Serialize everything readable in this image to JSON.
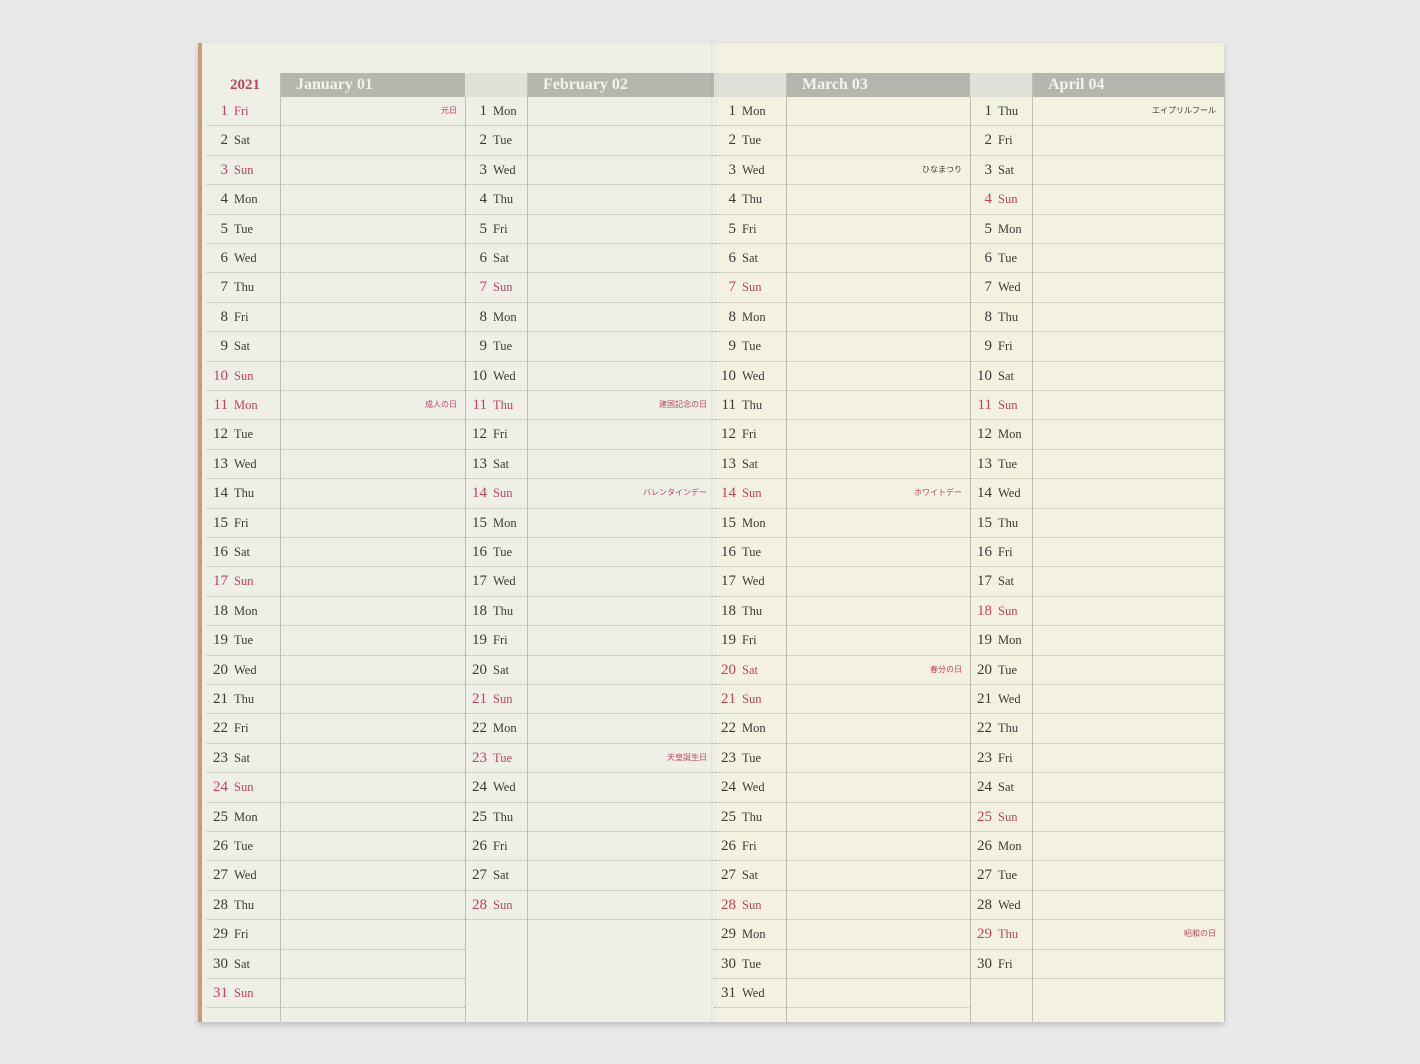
{
  "year": "2021",
  "months": [
    {
      "title": "January 01",
      "days": [
        {
          "d": "1",
          "w": "Fri",
          "red": true,
          "note": "元日"
        },
        {
          "d": "2",
          "w": "Sat"
        },
        {
          "d": "3",
          "w": "Sun",
          "red": true
        },
        {
          "d": "4",
          "w": "Mon"
        },
        {
          "d": "5",
          "w": "Tue"
        },
        {
          "d": "6",
          "w": "Wed"
        },
        {
          "d": "7",
          "w": "Thu"
        },
        {
          "d": "8",
          "w": "Fri"
        },
        {
          "d": "9",
          "w": "Sat"
        },
        {
          "d": "10",
          "w": "Sun",
          "red": true
        },
        {
          "d": "11",
          "w": "Mon",
          "red": true,
          "note": "成人の日"
        },
        {
          "d": "12",
          "w": "Tue"
        },
        {
          "d": "13",
          "w": "Wed"
        },
        {
          "d": "14",
          "w": "Thu"
        },
        {
          "d": "15",
          "w": "Fri"
        },
        {
          "d": "16",
          "w": "Sat"
        },
        {
          "d": "17",
          "w": "Sun",
          "red": true
        },
        {
          "d": "18",
          "w": "Mon"
        },
        {
          "d": "19",
          "w": "Tue"
        },
        {
          "d": "20",
          "w": "Wed"
        },
        {
          "d": "21",
          "w": "Thu"
        },
        {
          "d": "22",
          "w": "Fri"
        },
        {
          "d": "23",
          "w": "Sat"
        },
        {
          "d": "24",
          "w": "Sun",
          "red": true
        },
        {
          "d": "25",
          "w": "Mon"
        },
        {
          "d": "26",
          "w": "Tue"
        },
        {
          "d": "27",
          "w": "Wed"
        },
        {
          "d": "28",
          "w": "Thu"
        },
        {
          "d": "29",
          "w": "Fri"
        },
        {
          "d": "30",
          "w": "Sat"
        },
        {
          "d": "31",
          "w": "Sun",
          "red": true
        }
      ]
    },
    {
      "title": "February 02",
      "days": [
        {
          "d": "1",
          "w": "Mon"
        },
        {
          "d": "2",
          "w": "Tue"
        },
        {
          "d": "3",
          "w": "Wed"
        },
        {
          "d": "4",
          "w": "Thu"
        },
        {
          "d": "5",
          "w": "Fri"
        },
        {
          "d": "6",
          "w": "Sat"
        },
        {
          "d": "7",
          "w": "Sun",
          "red": true
        },
        {
          "d": "8",
          "w": "Mon"
        },
        {
          "d": "9",
          "w": "Tue"
        },
        {
          "d": "10",
          "w": "Wed"
        },
        {
          "d": "11",
          "w": "Thu",
          "red": true,
          "note": "建国記念の日"
        },
        {
          "d": "12",
          "w": "Fri"
        },
        {
          "d": "13",
          "w": "Sat"
        },
        {
          "d": "14",
          "w": "Sun",
          "red": true,
          "note": "バレンタインデー"
        },
        {
          "d": "15",
          "w": "Mon"
        },
        {
          "d": "16",
          "w": "Tue"
        },
        {
          "d": "17",
          "w": "Wed"
        },
        {
          "d": "18",
          "w": "Thu"
        },
        {
          "d": "19",
          "w": "Fri"
        },
        {
          "d": "20",
          "w": "Sat"
        },
        {
          "d": "21",
          "w": "Sun",
          "red": true
        },
        {
          "d": "22",
          "w": "Mon"
        },
        {
          "d": "23",
          "w": "Tue",
          "red": true,
          "note": "天皇誕生日"
        },
        {
          "d": "24",
          "w": "Wed"
        },
        {
          "d": "25",
          "w": "Thu"
        },
        {
          "d": "26",
          "w": "Fri"
        },
        {
          "d": "27",
          "w": "Sat"
        },
        {
          "d": "28",
          "w": "Sun",
          "red": true
        }
      ]
    },
    {
      "title": "March 03",
      "days": [
        {
          "d": "1",
          "w": "Mon"
        },
        {
          "d": "2",
          "w": "Tue"
        },
        {
          "d": "3",
          "w": "Wed",
          "note": "ひなまつり",
          "noteBlack": true
        },
        {
          "d": "4",
          "w": "Thu"
        },
        {
          "d": "5",
          "w": "Fri"
        },
        {
          "d": "6",
          "w": "Sat"
        },
        {
          "d": "7",
          "w": "Sun",
          "red": true
        },
        {
          "d": "8",
          "w": "Mon"
        },
        {
          "d": "9",
          "w": "Tue"
        },
        {
          "d": "10",
          "w": "Wed"
        },
        {
          "d": "11",
          "w": "Thu"
        },
        {
          "d": "12",
          "w": "Fri"
        },
        {
          "d": "13",
          "w": "Sat"
        },
        {
          "d": "14",
          "w": "Sun",
          "red": true,
          "note": "ホワイトデー"
        },
        {
          "d": "15",
          "w": "Mon"
        },
        {
          "d": "16",
          "w": "Tue"
        },
        {
          "d": "17",
          "w": "Wed"
        },
        {
          "d": "18",
          "w": "Thu"
        },
        {
          "d": "19",
          "w": "Fri"
        },
        {
          "d": "20",
          "w": "Sat",
          "red": true,
          "note": "春分の日"
        },
        {
          "d": "21",
          "w": "Sun",
          "red": true
        },
        {
          "d": "22",
          "w": "Mon"
        },
        {
          "d": "23",
          "w": "Tue"
        },
        {
          "d": "24",
          "w": "Wed"
        },
        {
          "d": "25",
          "w": "Thu"
        },
        {
          "d": "26",
          "w": "Fri"
        },
        {
          "d": "27",
          "w": "Sat"
        },
        {
          "d": "28",
          "w": "Sun",
          "red": true
        },
        {
          "d": "29",
          "w": "Mon"
        },
        {
          "d": "30",
          "w": "Tue"
        },
        {
          "d": "31",
          "w": "Wed"
        }
      ]
    },
    {
      "title": "April 04",
      "days": [
        {
          "d": "1",
          "w": "Thu",
          "note": "エイプリルフール",
          "noteBlack": true
        },
        {
          "d": "2",
          "w": "Fri"
        },
        {
          "d": "3",
          "w": "Sat"
        },
        {
          "d": "4",
          "w": "Sun",
          "red": true
        },
        {
          "d": "5",
          "w": "Mon"
        },
        {
          "d": "6",
          "w": "Tue"
        },
        {
          "d": "7",
          "w": "Wed"
        },
        {
          "d": "8",
          "w": "Thu"
        },
        {
          "d": "9",
          "w": "Fri"
        },
        {
          "d": "10",
          "w": "Sat"
        },
        {
          "d": "11",
          "w": "Sun",
          "red": true
        },
        {
          "d": "12",
          "w": "Mon"
        },
        {
          "d": "13",
          "w": "Tue"
        },
        {
          "d": "14",
          "w": "Wed"
        },
        {
          "d": "15",
          "w": "Thu"
        },
        {
          "d": "16",
          "w": "Fri"
        },
        {
          "d": "17",
          "w": "Sat"
        },
        {
          "d": "18",
          "w": "Sun",
          "red": true
        },
        {
          "d": "19",
          "w": "Mon"
        },
        {
          "d": "20",
          "w": "Tue"
        },
        {
          "d": "21",
          "w": "Wed"
        },
        {
          "d": "22",
          "w": "Thu"
        },
        {
          "d": "23",
          "w": "Fri"
        },
        {
          "d": "24",
          "w": "Sat"
        },
        {
          "d": "25",
          "w": "Sun",
          "red": true
        },
        {
          "d": "26",
          "w": "Mon"
        },
        {
          "d": "27",
          "w": "Tue"
        },
        {
          "d": "28",
          "w": "Wed"
        },
        {
          "d": "29",
          "w": "Thu",
          "red": true,
          "note": "昭和の日"
        },
        {
          "d": "30",
          "w": "Fri"
        }
      ]
    }
  ]
}
